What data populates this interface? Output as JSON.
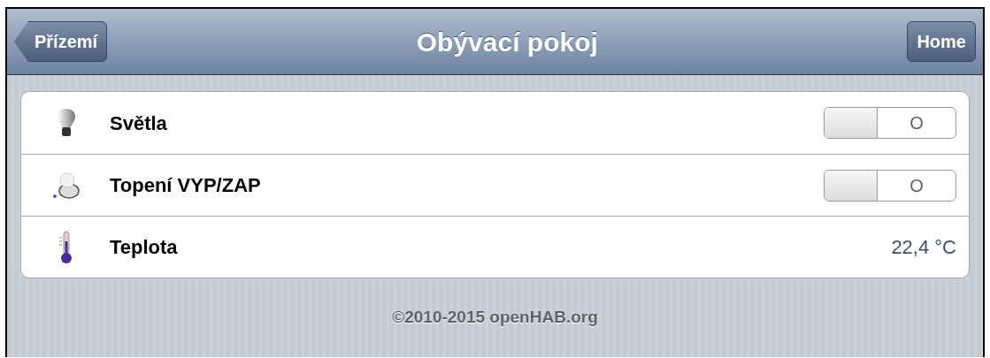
{
  "header": {
    "back_button": "Přízemí",
    "title": "Obývací pokoj",
    "home_button": "Home"
  },
  "items": [
    {
      "kind": "switch",
      "label": "Světla",
      "on": false,
      "switch_label": "O"
    },
    {
      "kind": "switch",
      "label": "Topení VYP/ZAP",
      "on": false,
      "switch_label": "O"
    },
    {
      "kind": "value",
      "label": "Teplota",
      "value": "22,4 °C"
    }
  ],
  "footer": "©2010-2015 openHAB.org"
}
